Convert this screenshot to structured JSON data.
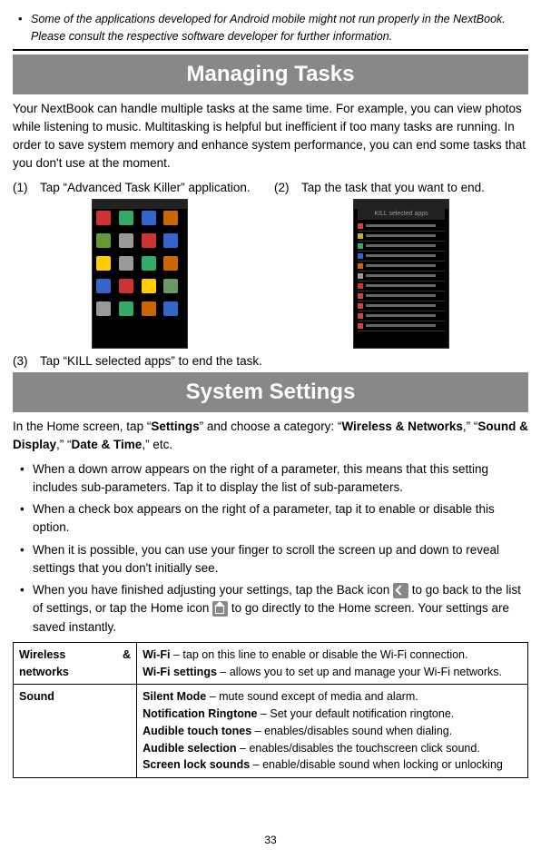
{
  "top_note": "Some of the applications developed for Android mobile might not run properly in the NextBook. Please consult the respective software developer for further information.",
  "section1": {
    "title": "Managing Tasks",
    "intro": "Your NextBook can handle multiple tasks at the same time. For example, you can view photos while listening to music. Multitasking is helpful but inefficient if too many tasks are running. In order to save system memory and enhance system performance, you can end some tasks that you don't use at the moment.",
    "steps": {
      "s1_num": "(1)",
      "s1_text": "Tap “Advanced Task Killer” application.",
      "s2_num": "(2)",
      "s2_text": "Tap the task that you want to end.",
      "s3_num": "(3)",
      "s3_text": "Tap “KILL selected apps” to end the task.",
      "kill_header": "KILL selected apps"
    }
  },
  "section2": {
    "title": "System Settings",
    "intro_pre": "In the Home screen, tap “",
    "intro_b1": "Settings",
    "intro_mid1": "” and choose a category: “",
    "intro_b2": "Wireless & Networks",
    "intro_mid2": ",” “",
    "intro_b3": "Sound & Display",
    "intro_mid3": ",” “",
    "intro_b4": "Date & Time",
    "intro_post": ",” etc.",
    "bullets": {
      "b1": "When a down arrow appears on the right of a parameter, this means that this setting includes sub-parameters. Tap it to display the list of sub-parameters.",
      "b2": "When a check box appears on the right of a parameter, tap it to enable or disable this option.",
      "b3": "When it is possible, you can use your finger to scroll the screen up and down to reveal settings that you don't initially see.",
      "b4_pre": "When you have finished adjusting your settings, tap the Back icon ",
      "b4_mid": " to go back to the list of settings, or tap the Home icon ",
      "b4_post": " to go directly to the Home screen. Your settings are saved instantly."
    },
    "table": {
      "r1_left_a": "Wireless",
      "r1_left_amp": "&",
      "r1_left_b": "networks",
      "r1_b1": "Wi-Fi",
      "r1_t1": " – tap on this line to enable or disable the Wi-Fi connection.",
      "r1_b2": "Wi-Fi settings",
      "r1_t2": " – allows you to set up and manage your Wi-Fi networks.",
      "r2_left": "Sound",
      "r2_b1": "Silent Mode",
      "r2_t1": " – mute sound except of media and alarm.",
      "r2_b2": "Notification Ringtone",
      "r2_t2": " – Set your default notification ringtone.",
      "r2_b3": "Audible touch tones",
      "r2_t3": " – enables/disables sound when dialing.",
      "r2_b4": "Audible selection",
      "r2_t4": " – enables/disables the touchscreen click sound.",
      "r2_b5": "Screen lock sounds",
      "r2_t5": " – enable/disable sound when locking or unlocking"
    }
  },
  "page_number": "33"
}
